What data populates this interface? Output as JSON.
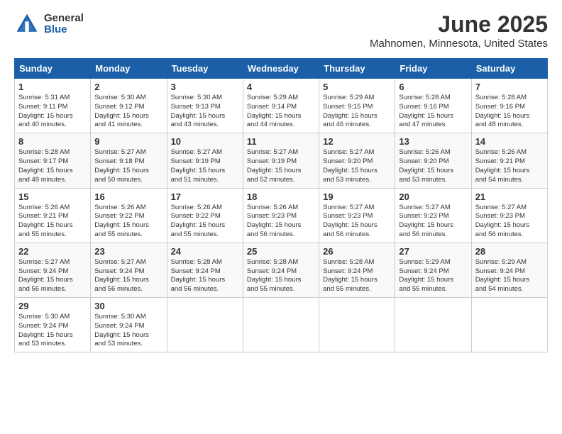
{
  "logo": {
    "general": "General",
    "blue": "Blue"
  },
  "header": {
    "month": "June 2025",
    "location": "Mahnomen, Minnesota, United States"
  },
  "weekdays": [
    "Sunday",
    "Monday",
    "Tuesday",
    "Wednesday",
    "Thursday",
    "Friday",
    "Saturday"
  ],
  "weeks": [
    [
      {
        "day": "1",
        "sunrise": "5:31 AM",
        "sunset": "9:11 PM",
        "daylight": "15 hours and 40 minutes."
      },
      {
        "day": "2",
        "sunrise": "5:30 AM",
        "sunset": "9:12 PM",
        "daylight": "15 hours and 41 minutes."
      },
      {
        "day": "3",
        "sunrise": "5:30 AM",
        "sunset": "9:13 PM",
        "daylight": "15 hours and 43 minutes."
      },
      {
        "day": "4",
        "sunrise": "5:29 AM",
        "sunset": "9:14 PM",
        "daylight": "15 hours and 44 minutes."
      },
      {
        "day": "5",
        "sunrise": "5:29 AM",
        "sunset": "9:15 PM",
        "daylight": "15 hours and 46 minutes."
      },
      {
        "day": "6",
        "sunrise": "5:28 AM",
        "sunset": "9:16 PM",
        "daylight": "15 hours and 47 minutes."
      },
      {
        "day": "7",
        "sunrise": "5:28 AM",
        "sunset": "9:16 PM",
        "daylight": "15 hours and 48 minutes."
      }
    ],
    [
      {
        "day": "8",
        "sunrise": "5:28 AM",
        "sunset": "9:17 PM",
        "daylight": "15 hours and 49 minutes."
      },
      {
        "day": "9",
        "sunrise": "5:27 AM",
        "sunset": "9:18 PM",
        "daylight": "15 hours and 50 minutes."
      },
      {
        "day": "10",
        "sunrise": "5:27 AM",
        "sunset": "9:19 PM",
        "daylight": "15 hours and 51 minutes."
      },
      {
        "day": "11",
        "sunrise": "5:27 AM",
        "sunset": "9:19 PM",
        "daylight": "15 hours and 52 minutes."
      },
      {
        "day": "12",
        "sunrise": "5:27 AM",
        "sunset": "9:20 PM",
        "daylight": "15 hours and 53 minutes."
      },
      {
        "day": "13",
        "sunrise": "5:26 AM",
        "sunset": "9:20 PM",
        "daylight": "15 hours and 53 minutes."
      },
      {
        "day": "14",
        "sunrise": "5:26 AM",
        "sunset": "9:21 PM",
        "daylight": "15 hours and 54 minutes."
      }
    ],
    [
      {
        "day": "15",
        "sunrise": "5:26 AM",
        "sunset": "9:21 PM",
        "daylight": "15 hours and 55 minutes."
      },
      {
        "day": "16",
        "sunrise": "5:26 AM",
        "sunset": "9:22 PM",
        "daylight": "15 hours and 55 minutes."
      },
      {
        "day": "17",
        "sunrise": "5:26 AM",
        "sunset": "9:22 PM",
        "daylight": "15 hours and 55 minutes."
      },
      {
        "day": "18",
        "sunrise": "5:26 AM",
        "sunset": "9:23 PM",
        "daylight": "15 hours and 56 minutes."
      },
      {
        "day": "19",
        "sunrise": "5:27 AM",
        "sunset": "9:23 PM",
        "daylight": "15 hours and 56 minutes."
      },
      {
        "day": "20",
        "sunrise": "5:27 AM",
        "sunset": "9:23 PM",
        "daylight": "15 hours and 56 minutes."
      },
      {
        "day": "21",
        "sunrise": "5:27 AM",
        "sunset": "9:23 PM",
        "daylight": "15 hours and 56 minutes."
      }
    ],
    [
      {
        "day": "22",
        "sunrise": "5:27 AM",
        "sunset": "9:24 PM",
        "daylight": "15 hours and 56 minutes."
      },
      {
        "day": "23",
        "sunrise": "5:27 AM",
        "sunset": "9:24 PM",
        "daylight": "15 hours and 56 minutes."
      },
      {
        "day": "24",
        "sunrise": "5:28 AM",
        "sunset": "9:24 PM",
        "daylight": "15 hours and 56 minutes."
      },
      {
        "day": "25",
        "sunrise": "5:28 AM",
        "sunset": "9:24 PM",
        "daylight": "15 hours and 55 minutes."
      },
      {
        "day": "26",
        "sunrise": "5:28 AM",
        "sunset": "9:24 PM",
        "daylight": "15 hours and 55 minutes."
      },
      {
        "day": "27",
        "sunrise": "5:29 AM",
        "sunset": "9:24 PM",
        "daylight": "15 hours and 55 minutes."
      },
      {
        "day": "28",
        "sunrise": "5:29 AM",
        "sunset": "9:24 PM",
        "daylight": "15 hours and 54 minutes."
      }
    ],
    [
      {
        "day": "29",
        "sunrise": "5:30 AM",
        "sunset": "9:24 PM",
        "daylight": "15 hours and 53 minutes."
      },
      {
        "day": "30",
        "sunrise": "5:30 AM",
        "sunset": "9:24 PM",
        "daylight": "15 hours and 53 minutes."
      },
      null,
      null,
      null,
      null,
      null
    ]
  ],
  "labels": {
    "sunrise": "Sunrise:",
    "sunset": "Sunset:",
    "daylight": "Daylight:"
  }
}
